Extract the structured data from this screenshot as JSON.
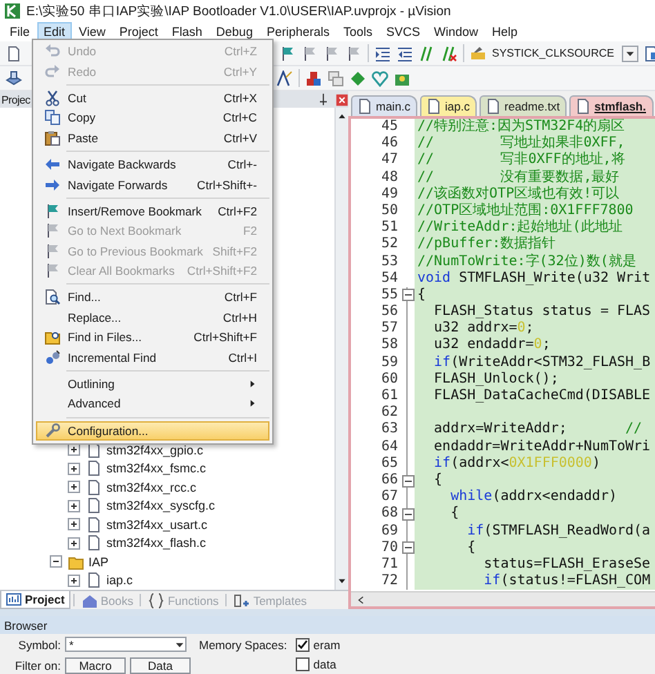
{
  "window": {
    "title": "E:\\实验50 串口IAP实验\\IAP Bootloader V1.0\\USER\\IAP.uvprojx - µVision"
  },
  "menu_bar": [
    {
      "label": "File",
      "selected": false
    },
    {
      "label": "Edit",
      "selected": true
    },
    {
      "label": "View",
      "selected": false
    },
    {
      "label": "Project",
      "selected": false
    },
    {
      "label": "Flash",
      "selected": false
    },
    {
      "label": "Debug",
      "selected": false
    },
    {
      "label": "Peripherals",
      "selected": false
    },
    {
      "label": "Tools",
      "selected": false
    },
    {
      "label": "SVCS",
      "selected": false
    },
    {
      "label": "Window",
      "selected": false
    },
    {
      "label": "Help",
      "selected": false
    }
  ],
  "toolbar": {
    "symbol_combo": {
      "value": "SYSTICK_CLKSOURCE"
    }
  },
  "edit_menu": [
    {
      "kind": "item",
      "label": "Undo",
      "shortcut": "Ctrl+Z",
      "disabled": true,
      "selected": false
    },
    {
      "kind": "item",
      "label": "Redo",
      "shortcut": "Ctrl+Y",
      "disabled": true,
      "selected": false
    },
    {
      "kind": "separator"
    },
    {
      "kind": "item",
      "label": "Cut",
      "shortcut": "Ctrl+X",
      "disabled": false,
      "selected": false
    },
    {
      "kind": "item",
      "label": "Copy",
      "shortcut": "Ctrl+C",
      "disabled": false,
      "selected": false
    },
    {
      "kind": "item",
      "label": "Paste",
      "shortcut": "Ctrl+V",
      "disabled": false,
      "selected": false
    },
    {
      "kind": "separator"
    },
    {
      "kind": "item",
      "label": "Navigate Backwards",
      "shortcut": "Ctrl+-",
      "disabled": false,
      "selected": false
    },
    {
      "kind": "item",
      "label": "Navigate Forwards",
      "shortcut": "Ctrl+Shift+-",
      "disabled": false,
      "selected": false
    },
    {
      "kind": "separator"
    },
    {
      "kind": "item",
      "label": "Insert/Remove Bookmark",
      "shortcut": "Ctrl+F2",
      "disabled": false,
      "selected": false
    },
    {
      "kind": "item",
      "label": "Go to Next Bookmark",
      "shortcut": "F2",
      "disabled": true,
      "selected": false
    },
    {
      "kind": "item",
      "label": "Go to Previous Bookmark",
      "shortcut": "Shift+F2",
      "disabled": true,
      "selected": false
    },
    {
      "kind": "item",
      "label": "Clear All Bookmarks",
      "shortcut": "Ctrl+Shift+F2",
      "disabled": true,
      "selected": false
    },
    {
      "kind": "separator"
    },
    {
      "kind": "item",
      "label": "Find...",
      "shortcut": "Ctrl+F",
      "disabled": false,
      "selected": false
    },
    {
      "kind": "item",
      "label": "Replace...",
      "shortcut": "Ctrl+H",
      "disabled": false,
      "selected": false
    },
    {
      "kind": "item",
      "label": "Find in Files...",
      "shortcut": "Ctrl+Shift+F",
      "disabled": false,
      "selected": false
    },
    {
      "kind": "item",
      "label": "Incremental Find",
      "shortcut": "Ctrl+I",
      "disabled": false,
      "selected": false
    },
    {
      "kind": "separator"
    },
    {
      "kind": "submenu",
      "label": "Outlining",
      "disabled": false,
      "selected": false
    },
    {
      "kind": "submenu",
      "label": "Advanced",
      "disabled": false,
      "selected": false
    },
    {
      "kind": "separator"
    },
    {
      "kind": "item",
      "label": "Configuration...",
      "disabled": false,
      "selected": true
    }
  ],
  "project_panel": {
    "title": "Projec",
    "tree": [
      {
        "expanded": true,
        "children": [
          {
            "kind": "file",
            "label": "stm32f4xx_gpio.c",
            "expanded": false
          },
          {
            "kind": "file",
            "label": "stm32f4xx_fsmc.c",
            "expanded": false
          },
          {
            "kind": "file",
            "label": "stm32f4xx_rcc.c",
            "expanded": false
          },
          {
            "kind": "file",
            "label": "stm32f4xx_syscfg.c",
            "expanded": false
          },
          {
            "kind": "file",
            "label": "stm32f4xx_usart.c",
            "expanded": false
          },
          {
            "kind": "file",
            "label": "stm32f4xx_flash.c",
            "expanded": false
          }
        ]
      },
      {
        "kind": "folder",
        "label": "IAP",
        "expanded": true,
        "children": [
          {
            "kind": "file",
            "label": "iap.c",
            "expanded": false
          }
        ]
      }
    ],
    "tabs": [
      {
        "label": "Project",
        "selected": true
      },
      {
        "label": "Books",
        "selected": false
      },
      {
        "label": "Functions",
        "selected": false
      },
      {
        "label": "Templates",
        "selected": false
      }
    ]
  },
  "editor": {
    "tabs": [
      {
        "label": "main.c",
        "color": "#dce3f0",
        "selected": false
      },
      {
        "label": "iap.c",
        "color": "#fbeea0",
        "selected": false
      },
      {
        "label": "readme.txt",
        "color": "#d9e2c8",
        "selected": false
      },
      {
        "label": "stmflash.",
        "color": "#f3c9c9",
        "selected": true
      }
    ],
    "lines": [
      {
        "number": "45",
        "fold": false,
        "tokens": [
          {
            "kind": "comment",
            "text": "//特别注意:因为STM32F4的扇区"
          }
        ]
      },
      {
        "number": "46",
        "fold": false,
        "tokens": [
          {
            "kind": "comment",
            "text": "//        写地址如果非0XFF,"
          }
        ]
      },
      {
        "number": "47",
        "fold": false,
        "tokens": [
          {
            "kind": "comment",
            "text": "//        写非0XFF的地址,将"
          }
        ]
      },
      {
        "number": "48",
        "fold": false,
        "tokens": [
          {
            "kind": "comment",
            "text": "//        没有重要数据,最好"
          }
        ]
      },
      {
        "number": "49",
        "fold": false,
        "tokens": [
          {
            "kind": "comment",
            "text": "//该函数对OTP区域也有效!可以"
          }
        ]
      },
      {
        "number": "50",
        "fold": false,
        "tokens": [
          {
            "kind": "comment",
            "text": "//OTP区域地址范围:0X1FFF7800"
          }
        ]
      },
      {
        "number": "51",
        "fold": false,
        "tokens": [
          {
            "kind": "comment",
            "text": "//WriteAddr:起始地址(此地址"
          }
        ]
      },
      {
        "number": "52",
        "fold": false,
        "tokens": [
          {
            "kind": "comment",
            "text": "//pBuffer:数据指针"
          }
        ]
      },
      {
        "number": "53",
        "fold": false,
        "tokens": [
          {
            "kind": "comment",
            "text": "//NumToWrite:字(32位)数(就是"
          }
        ]
      },
      {
        "number": "54",
        "fold": false,
        "tokens": [
          {
            "kind": "keyword",
            "text": "void"
          },
          {
            "kind": "plain",
            "text": " STMFLASH_Write(u32 Writ"
          }
        ]
      },
      {
        "number": "55",
        "fold": true,
        "tokens": [
          {
            "kind": "plain",
            "text": "{"
          }
        ]
      },
      {
        "number": "56",
        "fold": false,
        "tokens": [
          {
            "kind": "plain",
            "text": "  FLASH_Status status = FLAS"
          }
        ]
      },
      {
        "number": "57",
        "fold": false,
        "tokens": [
          {
            "kind": "plain",
            "text": "  u32 addrx="
          },
          {
            "kind": "number",
            "text": "0"
          },
          {
            "kind": "plain",
            "text": ";"
          }
        ]
      },
      {
        "number": "58",
        "fold": false,
        "tokens": [
          {
            "kind": "plain",
            "text": "  u32 endaddr="
          },
          {
            "kind": "number",
            "text": "0"
          },
          {
            "kind": "plain",
            "text": ";"
          }
        ]
      },
      {
        "number": "59",
        "fold": false,
        "tokens": [
          {
            "kind": "keyword",
            "text": "  if"
          },
          {
            "kind": "plain",
            "text": "(WriteAddr<STM32_FLASH_B"
          }
        ]
      },
      {
        "number": "60",
        "fold": false,
        "tokens": [
          {
            "kind": "plain",
            "text": "  FLASH_Unlock();"
          }
        ]
      },
      {
        "number": "61",
        "fold": false,
        "tokens": [
          {
            "kind": "plain",
            "text": "  FLASH_DataCacheCmd(DISABLE"
          }
        ]
      },
      {
        "number": "62",
        "fold": false
      },
      {
        "number": "63",
        "fold": false,
        "tokens": [
          {
            "kind": "plain",
            "text": "  addrx=WriteAddr;       "
          },
          {
            "kind": "comment",
            "text": "//"
          }
        ]
      },
      {
        "number": "64",
        "fold": false,
        "tokens": [
          {
            "kind": "plain",
            "text": "  endaddr=WriteAddr+NumToWri"
          }
        ]
      },
      {
        "number": "65",
        "fold": false,
        "tokens": [
          {
            "kind": "keyword",
            "text": "  if"
          },
          {
            "kind": "plain",
            "text": "(addrx<"
          },
          {
            "kind": "number",
            "text": "0X1FFF0000"
          },
          {
            "kind": "plain",
            "text": ")"
          }
        ]
      },
      {
        "number": "66",
        "fold": true,
        "tokens": [
          {
            "kind": "plain",
            "text": "  {"
          }
        ]
      },
      {
        "number": "67",
        "fold": false,
        "tokens": [
          {
            "kind": "keyword",
            "text": "    while"
          },
          {
            "kind": "plain",
            "text": "(addrx<endaddr)"
          }
        ]
      },
      {
        "number": "68",
        "fold": true,
        "tokens": [
          {
            "kind": "plain",
            "text": "    {"
          }
        ]
      },
      {
        "number": "69",
        "fold": false,
        "tokens": [
          {
            "kind": "keyword",
            "text": "      if"
          },
          {
            "kind": "plain",
            "text": "(STMFLASH_ReadWord(a"
          }
        ]
      },
      {
        "number": "70",
        "fold": true,
        "tokens": [
          {
            "kind": "plain",
            "text": "      {"
          }
        ]
      },
      {
        "number": "71",
        "fold": false,
        "tokens": [
          {
            "kind": "plain",
            "text": "        status=FLASH_EraseSe"
          }
        ]
      },
      {
        "number": "72",
        "fold": false,
        "tokens": [
          {
            "kind": "keyword",
            "text": "        if"
          },
          {
            "kind": "plain",
            "text": "(status!=FLASH_COM"
          }
        ]
      }
    ]
  },
  "browser": {
    "title": "Browser",
    "symbol_label": "Symbol:",
    "symbol_value": "*",
    "memory_spaces_label": "Memory Spaces:",
    "memory_spaces": [
      {
        "label": "eram",
        "checked": true
      },
      {
        "label": "data",
        "checked": false
      }
    ],
    "filter_label": "Filter on:",
    "filter_buttons": [
      "Macro",
      "Data"
    ]
  }
}
